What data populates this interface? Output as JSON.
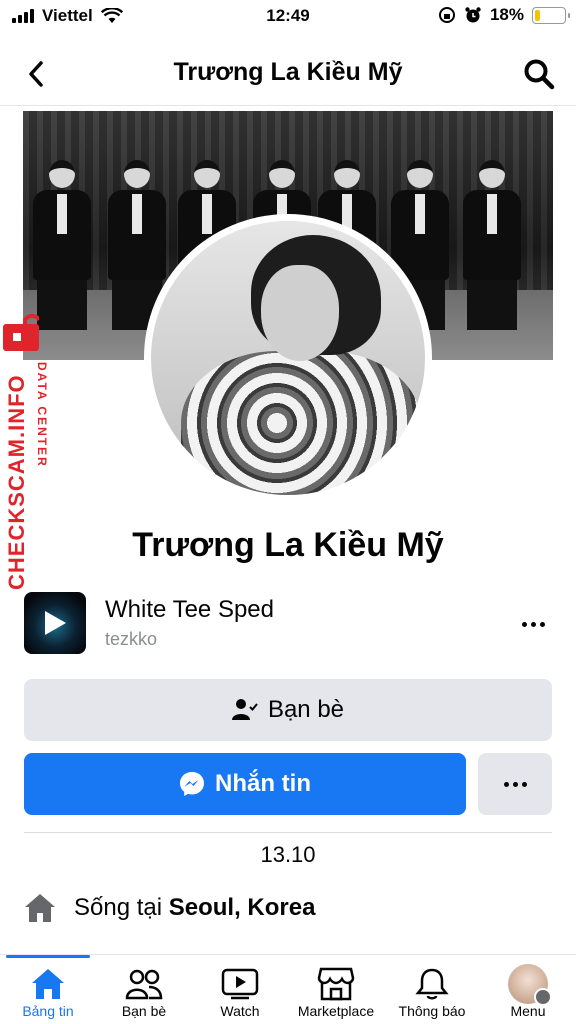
{
  "status_bar": {
    "carrier": "Viettel",
    "time": "12:49",
    "battery": "18%",
    "battery_level": 0.18,
    "battery_color": "#f5c400"
  },
  "header": {
    "back_icon": "chevron-left-icon",
    "title": "Trương La Kiều Mỹ",
    "search_icon": "search-icon"
  },
  "profile": {
    "name": "Trương La Kiều Mỹ"
  },
  "music": {
    "title": "White Tee Sped",
    "artist": "tezkko"
  },
  "actions": {
    "friends_label": "Bạn bè",
    "message_label": "Nhắn tin",
    "accent": "#1877f2"
  },
  "details": {
    "birthday": "13.10",
    "lives_prefix": "Sống tại",
    "lives_place": "Seoul, Korea"
  },
  "watermark": {
    "main": "CHECKSCAM.INFO",
    "sub": "DATA CENTER"
  },
  "tabs": [
    {
      "label": "Bảng tin",
      "icon": "home-icon",
      "active": true
    },
    {
      "label": "Bạn bè",
      "icon": "friends-icon",
      "active": false
    },
    {
      "label": "Watch",
      "icon": "watch-icon",
      "active": false
    },
    {
      "label": "Marketplace",
      "icon": "marketplace-icon",
      "active": false
    },
    {
      "label": "Thông báo",
      "icon": "bell-icon",
      "active": false
    },
    {
      "label": "Menu",
      "icon": "menu-avatar",
      "active": false
    }
  ]
}
